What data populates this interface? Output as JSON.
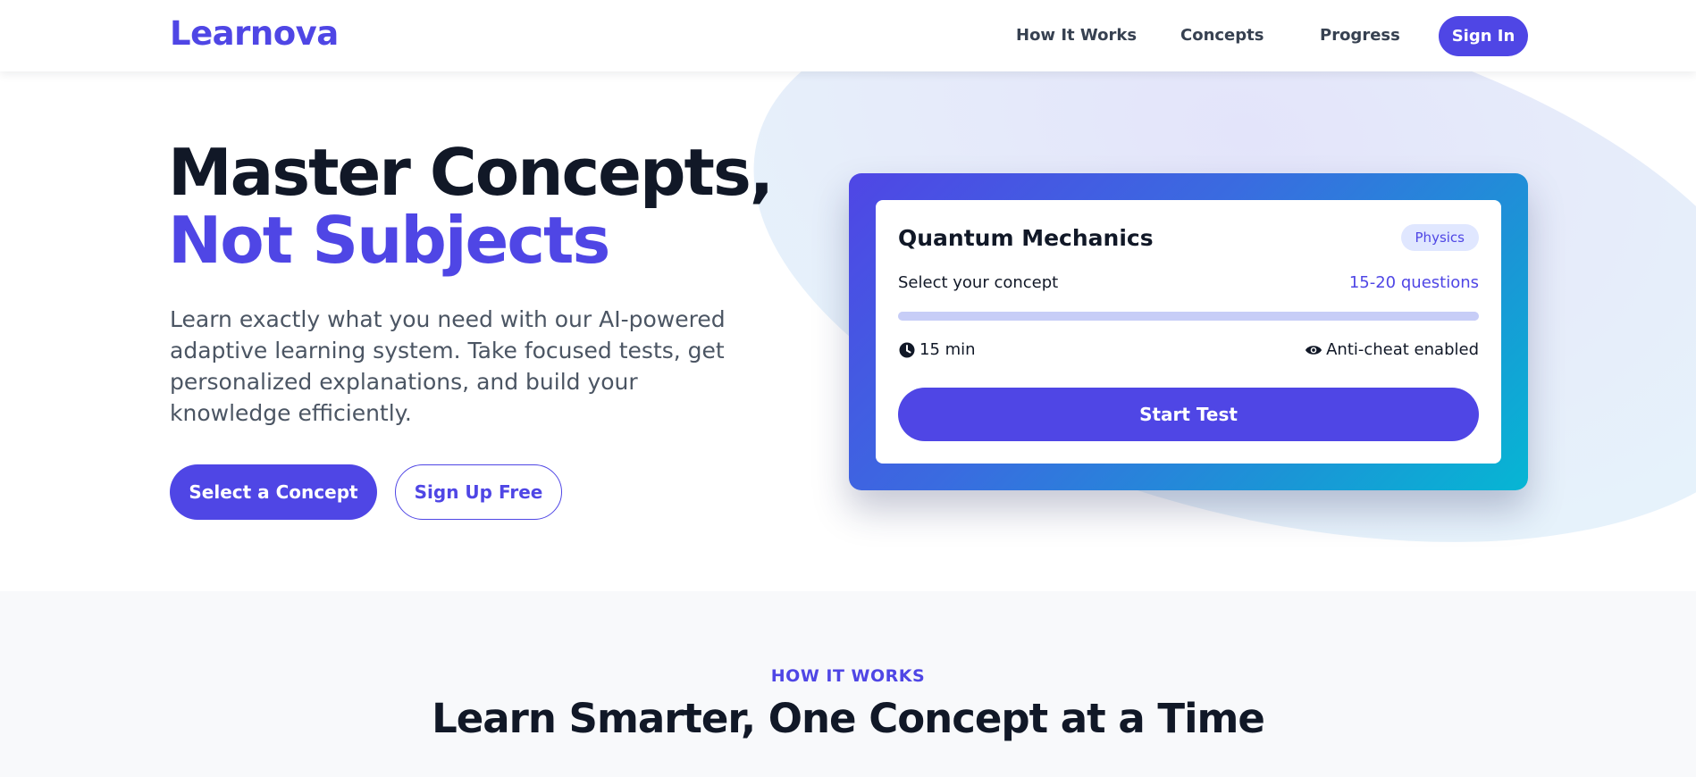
{
  "header": {
    "logo": "Learnova",
    "nav": [
      "How It Works",
      "Concepts",
      "Progress"
    ],
    "signin_label": "Sign In"
  },
  "hero": {
    "title_line1": "Master Concepts,",
    "title_line2": "Not Subjects",
    "description": "Learn exactly what you need with our AI-powered adaptive learning system. Take focused tests, get personalized explanations, and build your knowledge efficiently.",
    "primary_button": "Select a Concept",
    "secondary_button": "Sign Up Free"
  },
  "card": {
    "title": "Quantum Mechanics",
    "tag": "Physics",
    "concept_label": "Select your concept",
    "questions": "15-20 questions",
    "progress": 1.0,
    "duration": "15 min",
    "anticheat": "Anti-cheat enabled",
    "start_button": "Start Test"
  },
  "how_it_works": {
    "eyebrow": "HOW IT WORKS",
    "title": "Learn Smarter, One Concept at a Time"
  },
  "colors": {
    "accent": "#4f46e5",
    "text": "#111827",
    "gradient_end": "#06b6d4"
  },
  "icons": {
    "duration": "clock-icon",
    "anticheat": "eye-icon"
  }
}
